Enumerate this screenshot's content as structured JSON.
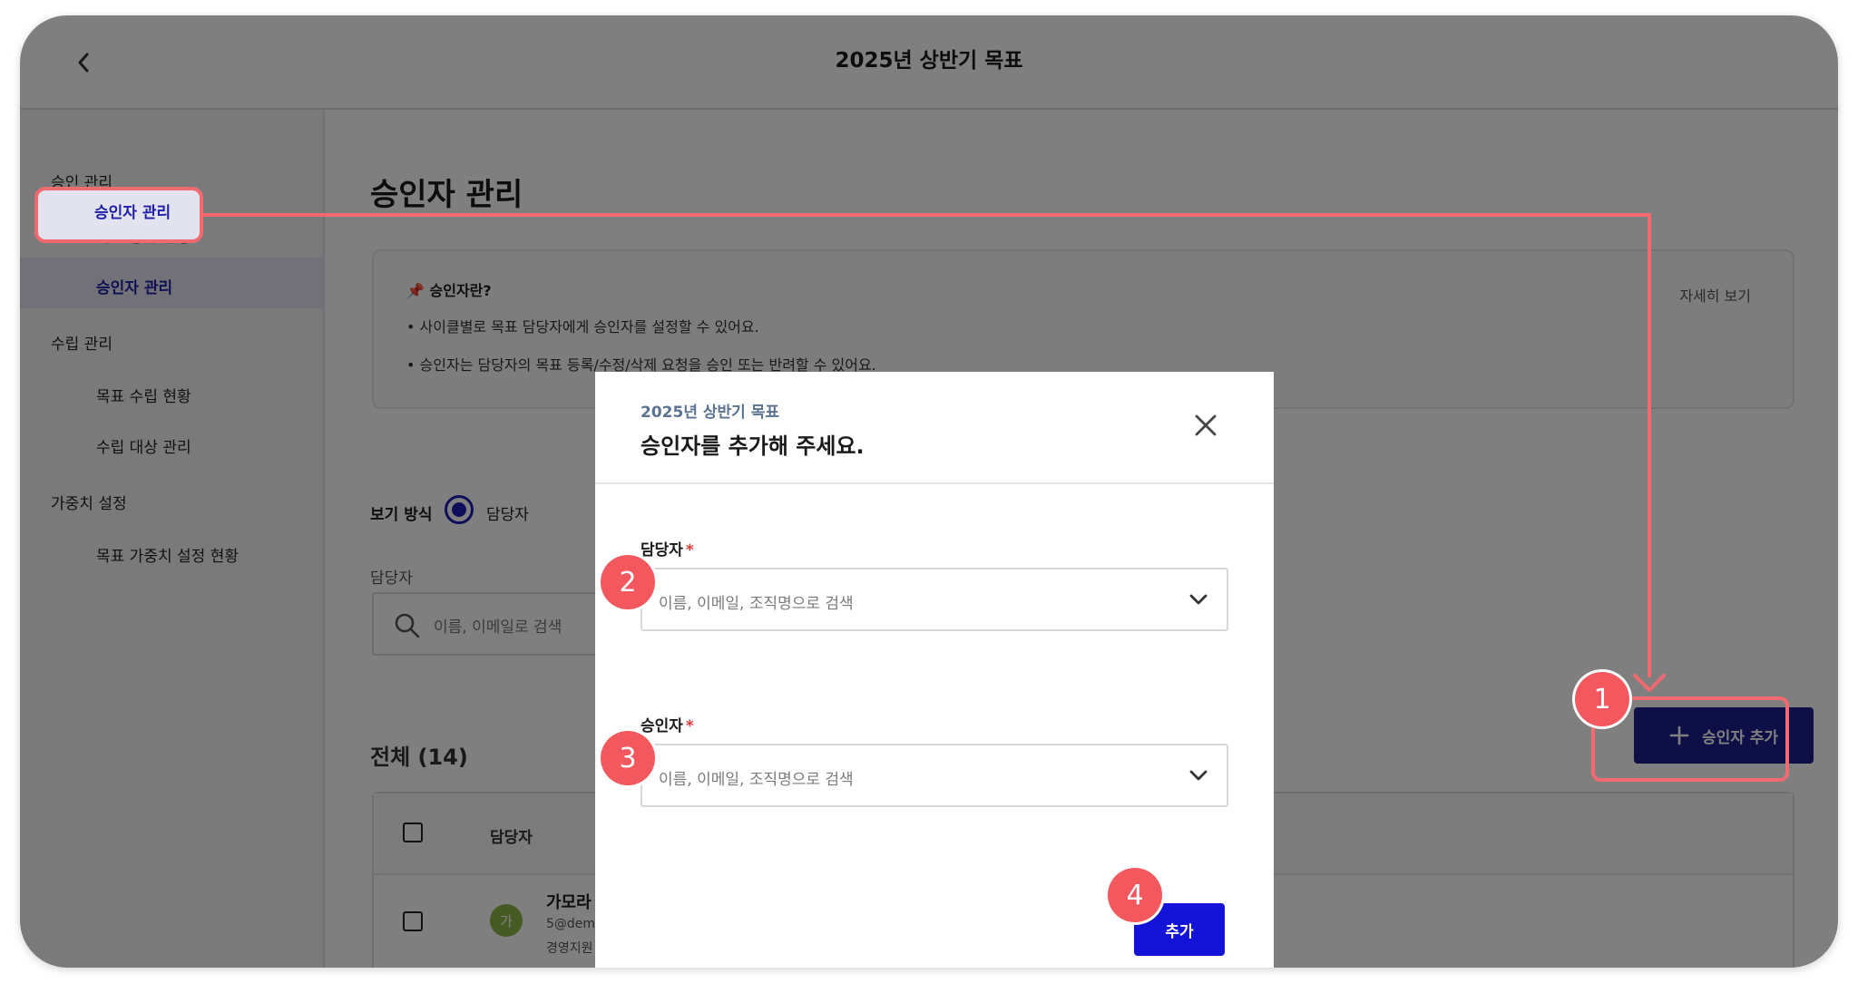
{
  "header": {
    "title": "2025년 상반기 목표"
  },
  "sidebar": {
    "groups": [
      {
        "label": "승인 관리",
        "items": [
          "목표 승인 현황",
          "승인자 관리"
        ]
      },
      {
        "label": "수립 관리",
        "items": [
          "목표 수립 현황",
          "수립 대상 관리"
        ]
      },
      {
        "label": "가중치 설정",
        "items": [
          "목표 가중치 설정 현황"
        ]
      }
    ],
    "active_item": "승인자 관리"
  },
  "main": {
    "title": "승인자 관리",
    "info": {
      "icon": "pin-icon",
      "heading": "승인자란?",
      "lines": [
        "사이클별로 목표 담당자에게 승인자를 설정할 수 있어요.",
        "승인자는 담당자의 목표 등록/수정/삭제 요청을 승인 또는 반려할 수 있어요."
      ],
      "more_label": "자세히 보기"
    },
    "view": {
      "label": "보기 방식",
      "selected_option": "담당자"
    },
    "filter": {
      "label": "담당자",
      "placeholder": "이름, 이메일로 검색"
    },
    "count_label": "전체 (14)",
    "add_button": "승인자 추가",
    "table": {
      "column": "담당자",
      "rows": [
        {
          "avatar": "가",
          "name": "가모라",
          "email": "5@dem",
          "dept": "경영지원"
        }
      ]
    }
  },
  "modal": {
    "subtitle": "2025년 상반기 목표",
    "title": "승인자를 추가해 주세요.",
    "fields": [
      {
        "label": "담당자",
        "required_mark": "*",
        "placeholder": "이름, 이메일, 조직명으로 검색"
      },
      {
        "label": "승인자",
        "required_mark": "*",
        "placeholder": "이름, 이메일, 조직명으로 검색"
      }
    ],
    "submit": "추가"
  },
  "steps": [
    "1",
    "2",
    "3",
    "4"
  ],
  "colors": {
    "accent": "#1e1e90",
    "primary_button": "#1313d8",
    "annotation": "#f06a70",
    "badge": "#f4585f"
  }
}
